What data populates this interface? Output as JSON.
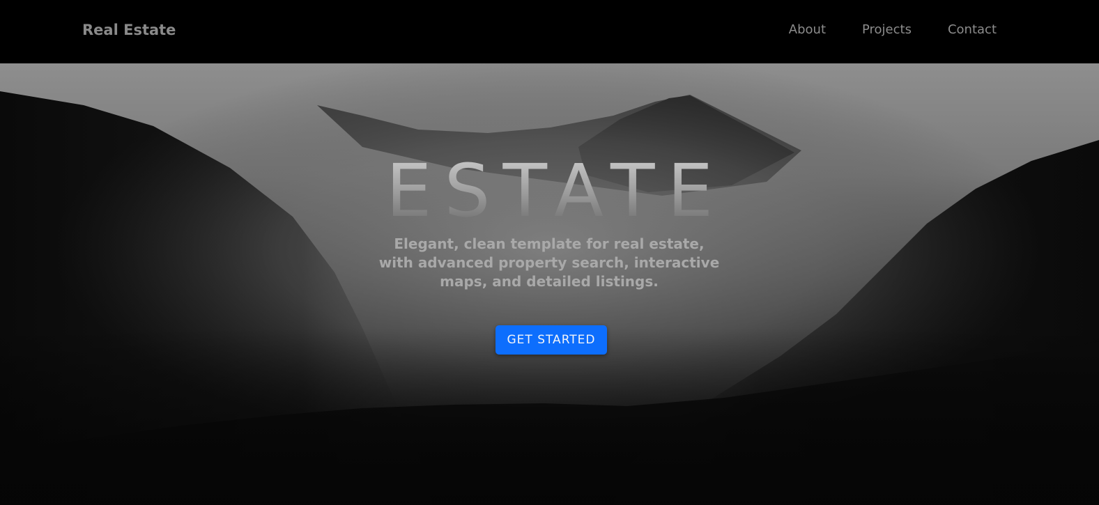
{
  "navbar": {
    "brand": "Real Estate",
    "links": [
      {
        "label": "About"
      },
      {
        "label": "Projects"
      },
      {
        "label": "Contact"
      }
    ]
  },
  "hero": {
    "title": "ESTATE",
    "subtitle": "Elegant, clean template for real estate, with advanced property search, interactive maps, and detailed listings.",
    "cta_label": "GET STARTED",
    "cta_color": "#0d6efd"
  }
}
